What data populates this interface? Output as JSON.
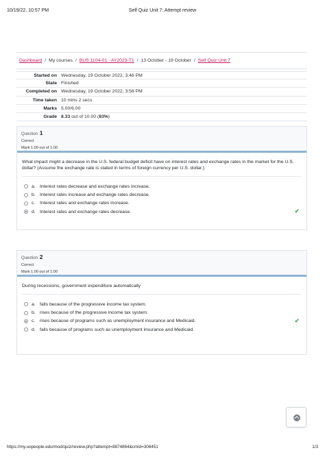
{
  "print_header": {
    "datetime": "10/19/22, 10:57 PM",
    "title": "Self Quiz Unit 7: Attempt review"
  },
  "breadcrumb": [
    {
      "label": "Dashboard",
      "link": true
    },
    {
      "label": "My courses",
      "link": false
    },
    {
      "label": "BUS 1104-01 - AY2023-T1",
      "link": true
    },
    {
      "label": "13 October - 19 October",
      "link": false
    },
    {
      "label": "Self Quiz Unit 7",
      "link": true
    }
  ],
  "summary": {
    "started_label": "Started on",
    "started_value": "Wednesday, 19 October 2022, 3:46 PM",
    "state_label": "State",
    "state_value": "Finished",
    "completed_label": "Completed on",
    "completed_value": "Wednesday, 19 October 2022, 3:56 PM",
    "time_label": "Time taken",
    "time_value": "10 mins 2 secs",
    "marks_label": "Marks",
    "marks_value": "5.00/6.00",
    "grade_label": "Grade",
    "grade_score": "8.33",
    "grade_mid": " out of 10.00 (",
    "grade_percent": "83%",
    "grade_end": ")"
  },
  "questions": [
    {
      "label": "Question",
      "number": "1",
      "state": "Correct",
      "mark": "Mark 1.00 out of 1.00",
      "text": "What impact might a decrease in the U.S. federal budget deficit have on interest rates and exchange rates in the market for the U.S. dollar? (Assume the exchange rate is stated in terms of foreign currency per U.S. dollar.)",
      "options": [
        {
          "letter": "a.",
          "text": "Interest rates decrease and exchange rates increase."
        },
        {
          "letter": "b.",
          "text": "Interest rates increase and exchange rates decrease."
        },
        {
          "letter": "c.",
          "text": "Interest rates and exchange rates increase."
        },
        {
          "letter": "d.",
          "text": "Interest rates and exchange rates decrease."
        }
      ],
      "selected": "d."
    },
    {
      "label": "Question",
      "number": "2",
      "state": "Correct",
      "mark": "Mark 1.00 out of 1.00",
      "text": "During recessions, government expenditure automatically",
      "options": [
        {
          "letter": "a.",
          "text": "falls because of the progressive income tax system."
        },
        {
          "letter": "b.",
          "text": "rises because of the progressive income tax system."
        },
        {
          "letter": "c.",
          "text": "rises because of programs such as unemployment insurance and Medicaid."
        },
        {
          "letter": "d.",
          "text": "falls because of programs such as unemployment insurance and Medicaid."
        }
      ],
      "selected": "c."
    }
  ],
  "check_icon": "checkmark-icon",
  "scroll_icon": "arrow-up-circle-icon",
  "print_footer": {
    "url": "https://my.uopeople.edu/mod/quiz/review.php?attempt=8874864&cmid=306451",
    "page": "1/3"
  },
  "colors": {
    "link": "#c2185b",
    "accent_bar": "#8eb3d2",
    "correct": "#2e9d3a"
  }
}
